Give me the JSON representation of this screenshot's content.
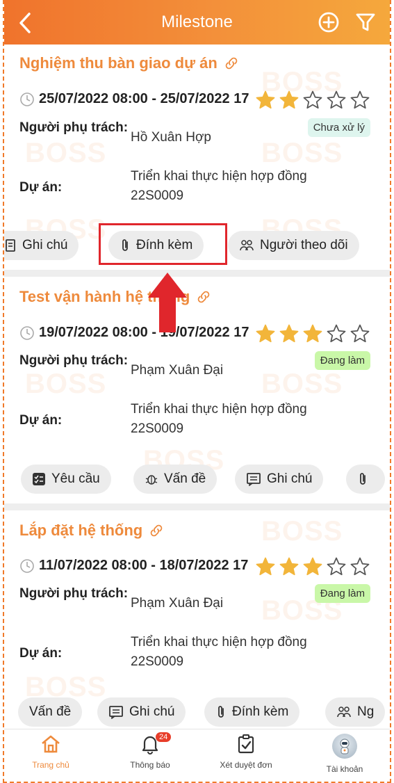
{
  "header": {
    "title": "Milestone"
  },
  "cards": [
    {
      "title": "Nghiệm thu bàn giao dự án",
      "date": "25/07/2022 08:00 - 25/07/2022 17",
      "owner_label": "Người phụ trách:",
      "owner": "Hồ Xuân Hợp",
      "project_label": "Dự án:",
      "project": "Triển khai thực hiện hợp đồng 22S0009",
      "status": "Chưa xử lý",
      "rating": 2,
      "chips": [
        "Ghi chú",
        "Đính kèm",
        "Người theo dõi"
      ]
    },
    {
      "title": "Test vận hành hệ thống",
      "date": "19/07/2022 08:00 - 19/07/2022 17",
      "owner_label": "Người phụ trách:",
      "owner": "Phạm Xuân Đại",
      "project_label": "Dự án:",
      "project": "Triển khai thực hiện hợp đồng 22S0009",
      "status": "Đang làm",
      "rating": 3,
      "chips": [
        "Yêu cầu",
        "Vấn đề",
        "Ghi chú",
        ""
      ]
    },
    {
      "title": "Lắp đặt hệ thống",
      "date": "11/07/2022 08:00 - 18/07/2022 17",
      "owner_label": "Người phụ trách:",
      "owner": "Phạm Xuân Đại",
      "project_label": "Dự án:",
      "project": "Triển khai thực hiện hợp đồng 22S0009",
      "status": "Đang làm",
      "rating": 3,
      "chips": [
        "Vấn đề",
        "Ghi chú",
        "Đính kèm",
        "Ng"
      ]
    }
  ],
  "watermark": "BOSS",
  "tabs": [
    {
      "label": "Trang chủ",
      "icon": "home-icon"
    },
    {
      "label": "Thông báo",
      "icon": "bell-icon",
      "badge": "24"
    },
    {
      "label": "Xét duyệt đơn",
      "icon": "clipboard-check-icon"
    },
    {
      "label": "Tài khoản",
      "icon": "avatar"
    }
  ],
  "colors": {
    "accent": "#ee8a3c",
    "header_start": "#f0732c",
    "header_end": "#f5a83c",
    "star": "#f2b53a",
    "highlight": "#e0262c"
  }
}
